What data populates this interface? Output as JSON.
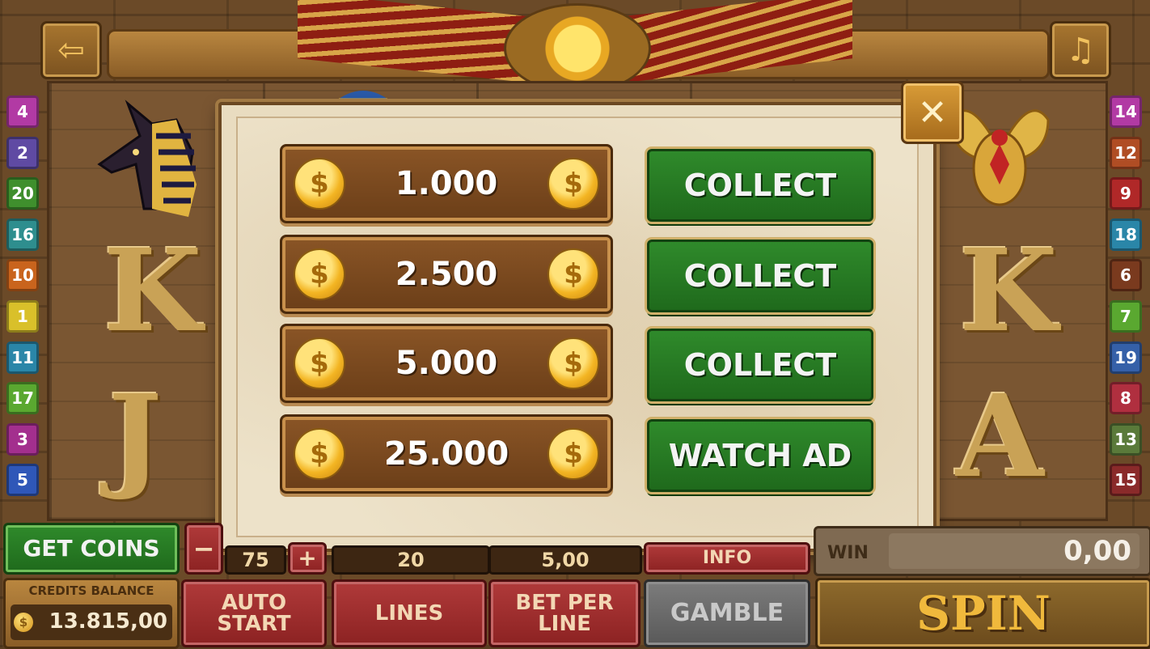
{
  "header": {
    "back_icon": "back-arrow-icon",
    "music_icon": "music-note-icon"
  },
  "line_numbers_left": [
    "4",
    "2",
    "20",
    "16",
    "10",
    "1",
    "11",
    "17",
    "3",
    "5"
  ],
  "line_numbers_right": [
    "14",
    "12",
    "9",
    "18",
    "6",
    "7",
    "19",
    "8",
    "13",
    "15"
  ],
  "line_colors_left": [
    "#b23aa4",
    "#5f4aa3",
    "#3f8f2d",
    "#2e8e8e",
    "#c9641d",
    "#d9c02a",
    "#2a86a8",
    "#5aa830",
    "#a32f8e",
    "#2f57b8"
  ],
  "line_colors_right": [
    "#b23aa4",
    "#b04d24",
    "#b02828",
    "#2a86a8",
    "#7a3a1e",
    "#5aa830",
    "#3560a8",
    "#b02f3f",
    "#5a7a3a",
    "#8a2a2a"
  ],
  "reels": {
    "symbols": {
      "anubis": "anubis-icon",
      "pharaoh": "pharaoh-icon",
      "scarab": "scarab-icon",
      "k_left": "K",
      "j_left": "J",
      "k_right": "K",
      "a_right": "A"
    }
  },
  "popup": {
    "close_label": "✕",
    "offers": [
      {
        "amount": "1.000",
        "action": "COLLECT"
      },
      {
        "amount": "2.500",
        "action": "COLLECT"
      },
      {
        "amount": "5.000",
        "action": "COLLECT"
      },
      {
        "amount": "25.000",
        "action": "WATCH AD"
      }
    ],
    "coin_symbol": "$"
  },
  "bottom": {
    "get_coins": "GET COINS",
    "minus": "−",
    "bet_value": "75",
    "plus": "+",
    "lines_value": "20",
    "bet_per_line_value": "5,00",
    "info": "INFO",
    "win_label": "WIN",
    "win_value": "0,00",
    "credits_label": "CREDITS BALANCE",
    "credits_value": "13.815,00",
    "credits_coin": "$",
    "auto_start": "AUTO START",
    "lines": "LINES",
    "bet_per_line": "BET PER LINE",
    "gamble": "GAMBLE",
    "spin": "SPIN"
  }
}
